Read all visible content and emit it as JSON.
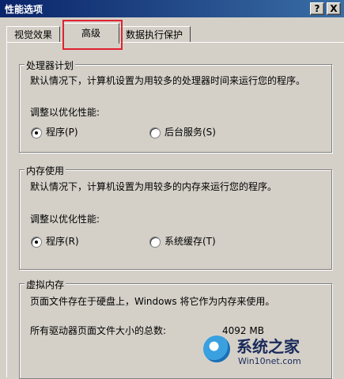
{
  "window": {
    "title": "性能选项",
    "help_btn": "?",
    "close_btn": "X"
  },
  "tabs": [
    {
      "label": "视觉效果"
    },
    {
      "label": "高级"
    },
    {
      "label": "数据执行保护"
    }
  ],
  "processor": {
    "legend": "处理器计划",
    "desc": "默认情况下，计算机设置为用较多的处理器时间来运行您的程序。",
    "adjust": "调整以优化性能:",
    "option1": "程序(P)",
    "option2": "后台服务(S)",
    "selected": "option1"
  },
  "memory": {
    "legend": "内存使用",
    "desc": "默认情况下，计算机设置为用较多的内存来运行您的程序。",
    "adjust": "调整以优化性能:",
    "option1": "程序(R)",
    "option2": "系统缓存(T)",
    "selected": "option1"
  },
  "virtual": {
    "legend": "虚拟内存",
    "desc": "页面文件存在于硬盘上，Windows 将它作为内存来使用。",
    "total_label": "所有驱动器页面文件大小的总数:",
    "total_value": "4092 MB"
  },
  "watermark": {
    "text1": "系统之家",
    "text2": "Win10net.com"
  },
  "colors": {
    "titlebar": "#0a246a",
    "dialog_bg": "#d4d0c8",
    "highlight": "#e0212f"
  }
}
